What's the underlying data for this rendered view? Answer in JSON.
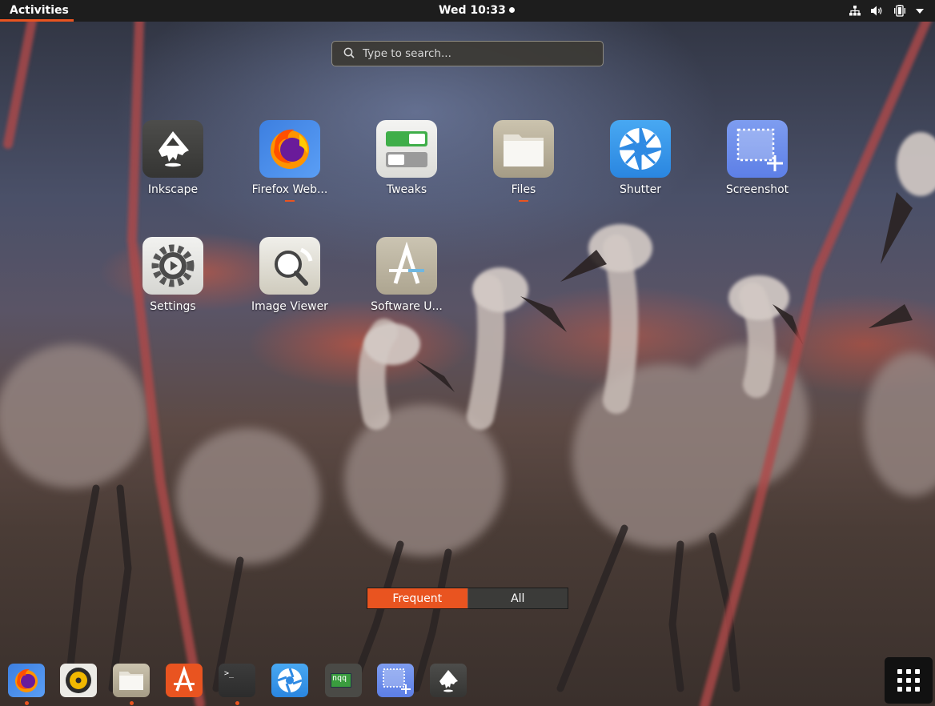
{
  "topbar": {
    "activities_label": "Activities",
    "clock": "Wed 10:33",
    "tray_icons": [
      "network-icon",
      "volume-icon",
      "battery-icon",
      "system-menu-arrow-icon"
    ]
  },
  "search": {
    "placeholder": "Type to search..."
  },
  "apps": [
    {
      "name": "Inkscape",
      "icon": "inkscape-icon",
      "running": false
    },
    {
      "name": "Firefox Web...",
      "icon": "firefox-icon",
      "running": true
    },
    {
      "name": "Tweaks",
      "icon": "tweaks-icon",
      "running": false
    },
    {
      "name": "Files",
      "icon": "files-icon",
      "running": true
    },
    {
      "name": "Shutter",
      "icon": "shutter-icon",
      "running": false
    },
    {
      "name": "Screenshot",
      "icon": "screenshot-icon",
      "running": false
    },
    {
      "name": "Settings",
      "icon": "settings-icon",
      "running": false
    },
    {
      "name": "Image Viewer",
      "icon": "image-viewer-icon",
      "running": false
    },
    {
      "name": "Software U...",
      "icon": "software-updater-icon",
      "running": false
    }
  ],
  "view_switcher": {
    "frequent": "Frequent",
    "all": "All",
    "active": "Frequent"
  },
  "dock": {
    "items": [
      {
        "icon": "firefox-icon",
        "running": true
      },
      {
        "icon": "rhythmbox-icon",
        "running": false
      },
      {
        "icon": "files-icon",
        "running": true
      },
      {
        "icon": "ubuntu-software-icon",
        "running": false
      },
      {
        "icon": "terminal-icon",
        "running": true
      },
      {
        "icon": "shutter-icon",
        "running": false
      },
      {
        "icon": "nqq-icon",
        "text": "nqq",
        "running": false
      },
      {
        "icon": "screenshot-icon",
        "running": false
      },
      {
        "icon": "inkscape-icon",
        "running": false
      }
    ],
    "terminal_prompt": ">_",
    "show_apps_icon": "show-applications-grid-icon"
  },
  "colors": {
    "accent": "#e95420",
    "topbar": "#1d1d1d"
  }
}
